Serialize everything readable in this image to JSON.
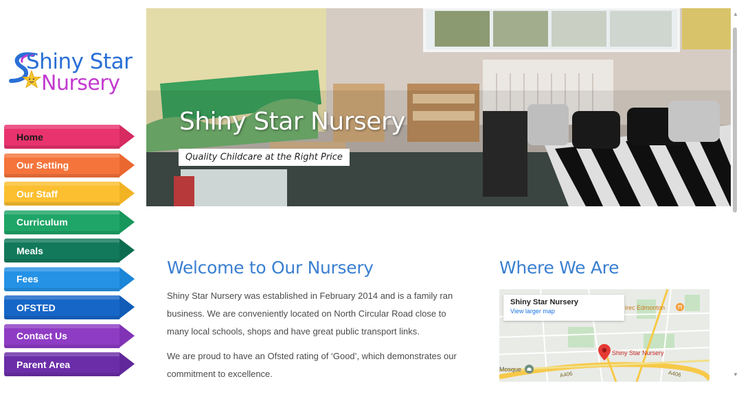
{
  "logo": {
    "line1": "Shiny Star",
    "line2": "Nursery"
  },
  "nav": [
    {
      "label": "Home",
      "color": "#e8336e",
      "tip": "#d62a61",
      "text_color": "#1a1a1a"
    },
    {
      "label": "Our Setting",
      "color": "#f5743b",
      "tip": "#ea6830",
      "text_color": "#ffffff"
    },
    {
      "label": "Our Staff",
      "color": "#fbbf2f",
      "tip": "#f2b323",
      "text_color": "#ffffff"
    },
    {
      "label": "Curriculum",
      "color": "#1ea567",
      "tip": "#17975b",
      "text_color": "#ffffff"
    },
    {
      "label": "Meals",
      "color": "#12795a",
      "tip": "#0d6c4f",
      "text_color": "#ffffff"
    },
    {
      "label": "Fees",
      "color": "#2592e6",
      "tip": "#1b85d8",
      "text_color": "#ffffff"
    },
    {
      "label": "OFSTED",
      "color": "#1666c7",
      "tip": "#115cb7",
      "text_color": "#ffffff"
    },
    {
      "label": "Contact Us",
      "color": "#8e3cc4",
      "tip": "#8133b6",
      "text_color": "#ffffff"
    },
    {
      "label": "Parent Area",
      "color": "#6b2ea8",
      "tip": "#60279a",
      "text_color": "#ffffff"
    }
  ],
  "hero": {
    "title": "Shiny Star Nursery",
    "tagline": "Quality Childcare at the Right Price"
  },
  "welcome": {
    "heading": "Welcome to Our Nursery",
    "p1": "Shiny Star Nursery was established in February 2014 and is a family ran business. We are conveniently located on North Circular Road close to many local schools, shops and have great public transport links.",
    "p2": "We are proud to have an Ofsted rating of ‘Good’, which demonstrates our commitment to excellence."
  },
  "where": {
    "heading": "Where We Are",
    "map": {
      "place_name": "Shiny Star Nursery",
      "view_link": "View larger map",
      "pin_label": "Shiny Star Nursery",
      "area_label": "irec Edmonton",
      "mosque_label": "Mosque",
      "road1": "A406",
      "road2": "A406"
    }
  }
}
